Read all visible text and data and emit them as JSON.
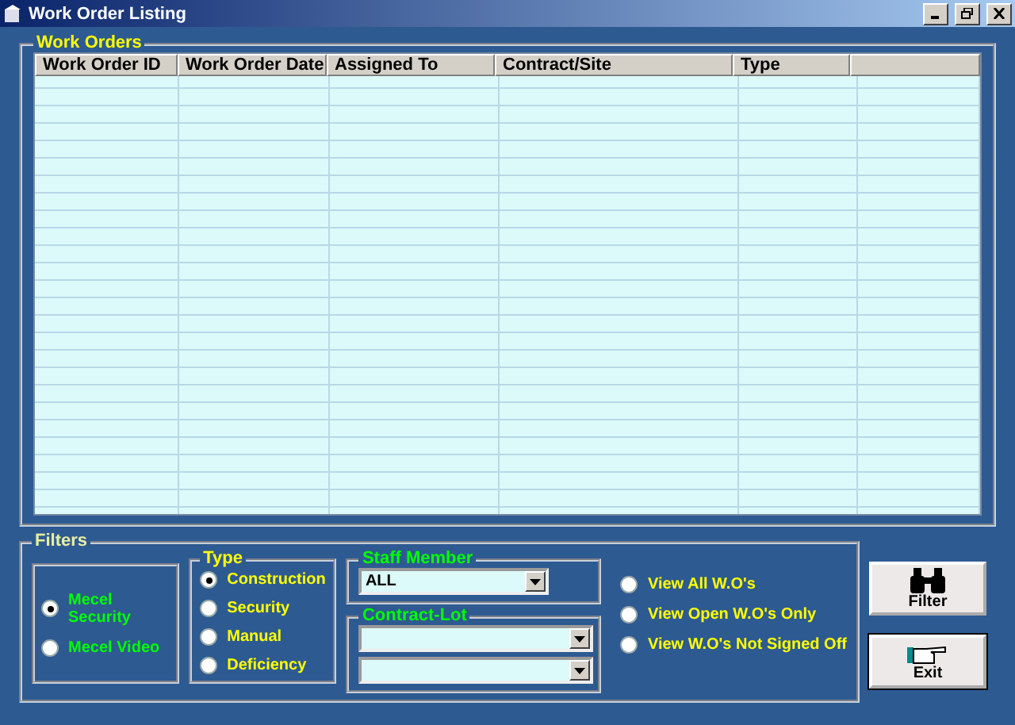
{
  "window": {
    "title": "Work Order Listing"
  },
  "work_orders": {
    "title": "Work Orders",
    "columns": [
      "Work Order ID",
      "Work Order Date",
      "Assigned To",
      "Contract/Site",
      "Type"
    ]
  },
  "filters": {
    "title": "Filters",
    "company": [
      {
        "label": "Mecel Security",
        "selected": true
      },
      {
        "label": "Mecel Video",
        "selected": false
      }
    ],
    "type": {
      "title": "Type",
      "options": [
        {
          "label": "Construction",
          "selected": true
        },
        {
          "label": "Security",
          "selected": false
        },
        {
          "label": "Manual",
          "selected": false
        },
        {
          "label": "Deficiency",
          "selected": false
        }
      ]
    },
    "staff_member": {
      "title": "Staff Member",
      "value": "ALL"
    },
    "contract_lot": {
      "title": "Contract-Lot",
      "fields": [
        {
          "kind": "dropdown"
        },
        {
          "kind": "dropdown"
        }
      ]
    },
    "view": [
      {
        "label": "View All W.O's",
        "selected": false
      },
      {
        "label": "View Open W.O's Only",
        "selected": false
      },
      {
        "label": "View W.O's Not Signed Off",
        "selected": false
      }
    ]
  },
  "buttons": [
    {
      "kind": "filter",
      "label": "Filter"
    },
    {
      "kind": "exit",
      "label": "Exit"
    }
  ]
}
